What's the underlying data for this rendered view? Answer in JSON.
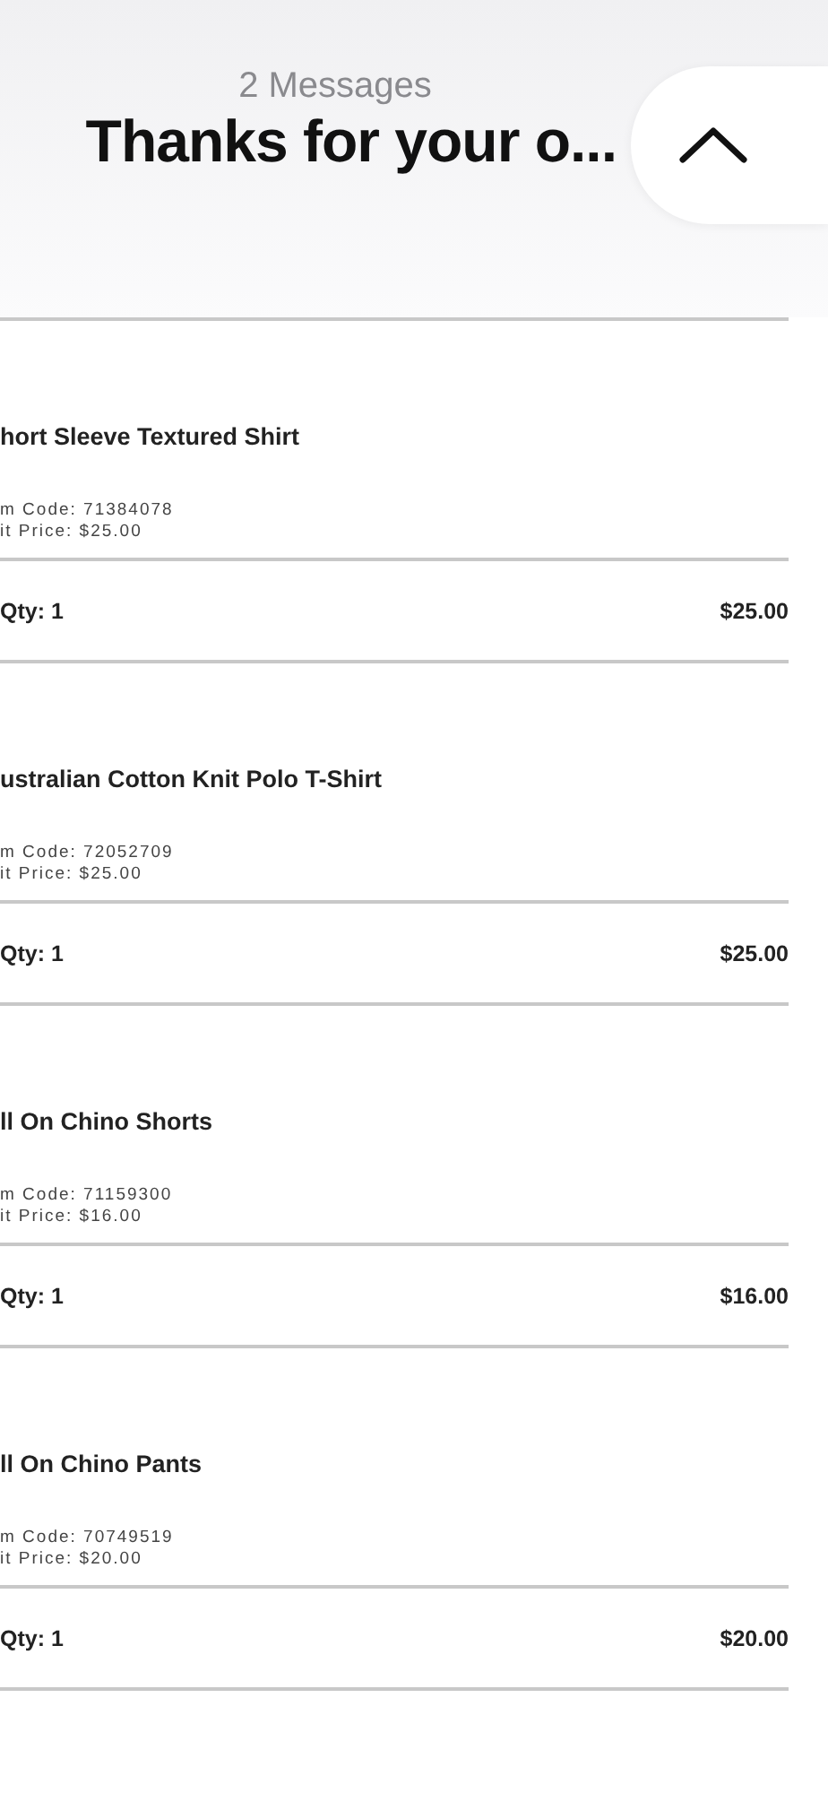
{
  "header": {
    "count": "2 Messages",
    "title": "Thanks for your o..."
  },
  "items": [
    {
      "name": "hort Sleeve Textured Shirt",
      "code": "m Code: 71384078",
      "price": "it Price: $25.00",
      "qty": "Qty: 1",
      "total": "$25.00"
    },
    {
      "name": "ustralian Cotton Knit Polo T-Shirt",
      "code": "m Code: 72052709",
      "price": "it Price: $25.00",
      "qty": "Qty: 1",
      "total": "$25.00"
    },
    {
      "name": "ll On Chino Shorts",
      "code": "m Code: 71159300",
      "price": "it Price: $16.00",
      "qty": "Qty: 1",
      "total": "$16.00"
    },
    {
      "name": "ll On Chino Pants",
      "code": "m Code: 70749519",
      "price": "it Price: $20.00",
      "qty": "Qty: 1",
      "total": "$20.00"
    }
  ]
}
